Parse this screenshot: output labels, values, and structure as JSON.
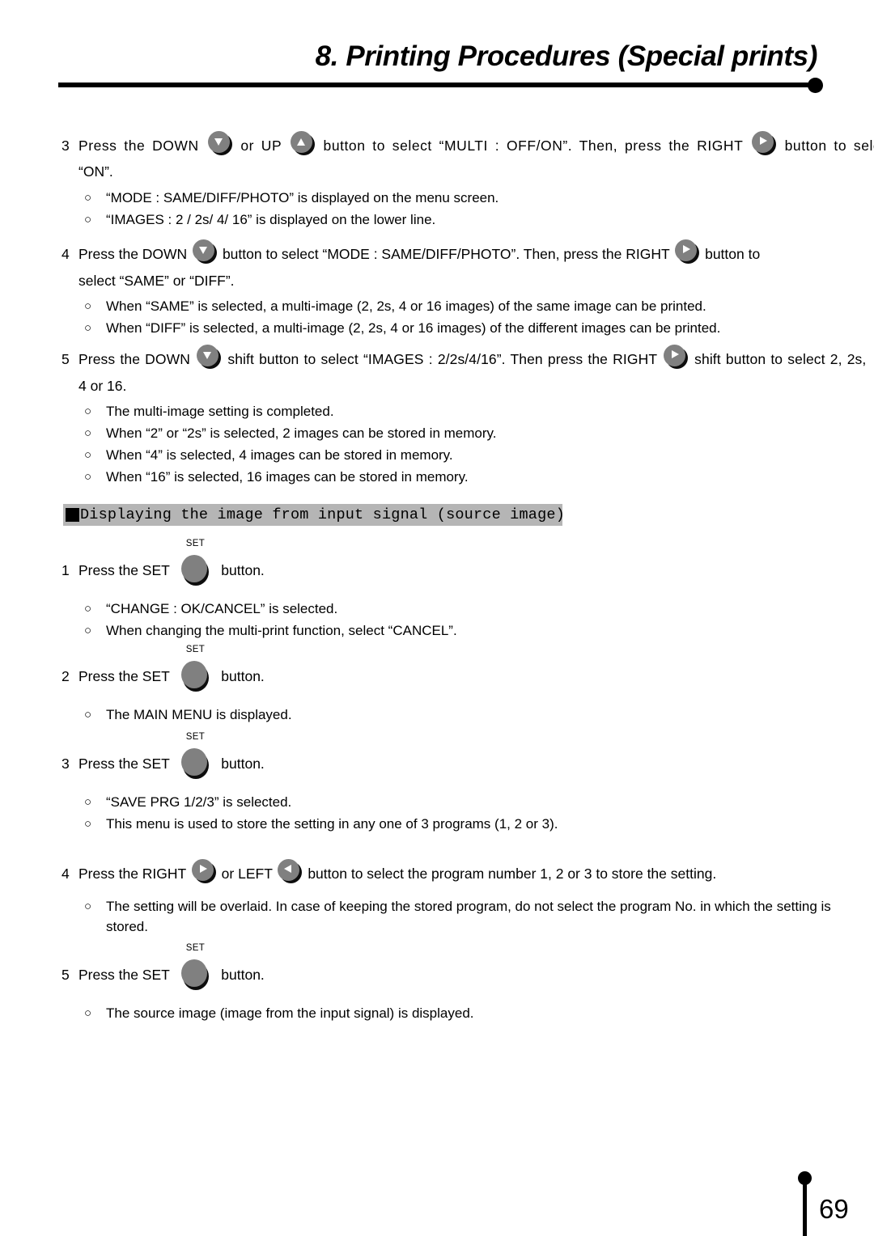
{
  "header": {
    "title": "8. Printing Procedures (Special prints)"
  },
  "steps": [
    {
      "number": "3",
      "line1_a": "Press the DOWN",
      "btn1": "down-arrow-button",
      "line1_b": "or UP",
      "btn2": "up-arrow-button",
      "line1_c": "button to select “MULTI  : OFF/ON”. Then, press the RIGHT",
      "btn3": "right-arrow-button",
      "line1_d": "button to select",
      "line2": "“ON”.",
      "bullets": [
        "“MODE  : SAME/DIFF/PHOTO”  is displayed on the menu screen.",
        "“IMAGES : 2 / 2s/ 4/ 16”  is displayed on the lower line."
      ]
    },
    {
      "number": "4",
      "line1_a": "Press the DOWN",
      "btn1": "down-arrow-button",
      "line1_b": "button to select “MODE  : SAME/DIFF/PHOTO”.  Then, press the RIGHT",
      "btn3": "right-arrow-button",
      "line1_d": "button  to",
      "line2": "select “SAME” or “DIFF”.",
      "bullets": [
        "When “SAME” is selected, a multi-image (2, 2s, 4 or 16 images) of the same image can be printed.",
        "When “DIFF” is selected, a multi-image (2, 2s, 4 or 16 images) of the different images can be printed."
      ]
    },
    {
      "number": "5",
      "line1_a": "Press the DOWN",
      "btn1": "down-arrow-button",
      "line1_b": "shift button to select “IMAGES : 2/2s/4/16”.  Then press the RIGHT",
      "btn3": "right-arrow-button",
      "line1_d": "shift button  to select 2, 2s,",
      "line2": "4 or 16.",
      "bullets": [
        "The multi-image setting is completed.",
        "When “2” or “2s” is selected, 2 images can be stored in memory.",
        "When “4” is selected, 4 images can be stored in memory.",
        "When “16” is selected, 16 images can be stored in memory."
      ]
    }
  ],
  "section": {
    "bullet_icon": "black-square",
    "title": "Displaying the image from input signal (source image)"
  },
  "section_steps": [
    {
      "number": "1",
      "text_before": "Press the SET",
      "button_label": "SET",
      "button_icon": "set-button",
      "text_after": "button.",
      "bullets": [
        "“CHANGE   : OK/CANCEL” is selected.",
        "When changing the multi-print function, select “CANCEL”."
      ]
    },
    {
      "number": "2",
      "text_before": "Press the SET",
      "button_label": "SET",
      "button_icon": "set-button",
      "text_after": "button.",
      "bullets": [
        "The MAIN MENU is displayed."
      ]
    },
    {
      "number": "3",
      "text_before": "Press the SET",
      "button_label": "SET",
      "button_icon": "set-button",
      "text_after": "button.",
      "bullets": [
        "“SAVE PRG 1/2/3” is selected.",
        "This menu is used to store the setting in any one of 3 programs (1, 2 or 3)."
      ]
    },
    {
      "number": "4",
      "text_before": "Press the RIGHT",
      "btn_right": "right-arrow-button",
      "text_middle": "or LEFT",
      "btn_left": "left-arrow-button",
      "text_after": "button to select the program number 1, 2 or 3 to store the setting.",
      "bullets": [
        "The setting will be overlaid.  In case of keeping the stored program, do not select the program No. in which the setting is",
        "stored."
      ]
    },
    {
      "number": "5",
      "text_before": "Press the SET",
      "button_label": "SET",
      "button_icon": "set-button",
      "text_after": "button.",
      "bullets": [
        "The source image (image from the input signal) is displayed."
      ]
    }
  ],
  "footer": {
    "page_number": "69"
  },
  "bullet_marker": "○",
  "colors": {
    "section_bar_bg": "#b5b5b5",
    "button_face": "#808080",
    "button_shadow": "#0d0d0d",
    "text": "#000000",
    "page_bg": "#ffffff"
  }
}
